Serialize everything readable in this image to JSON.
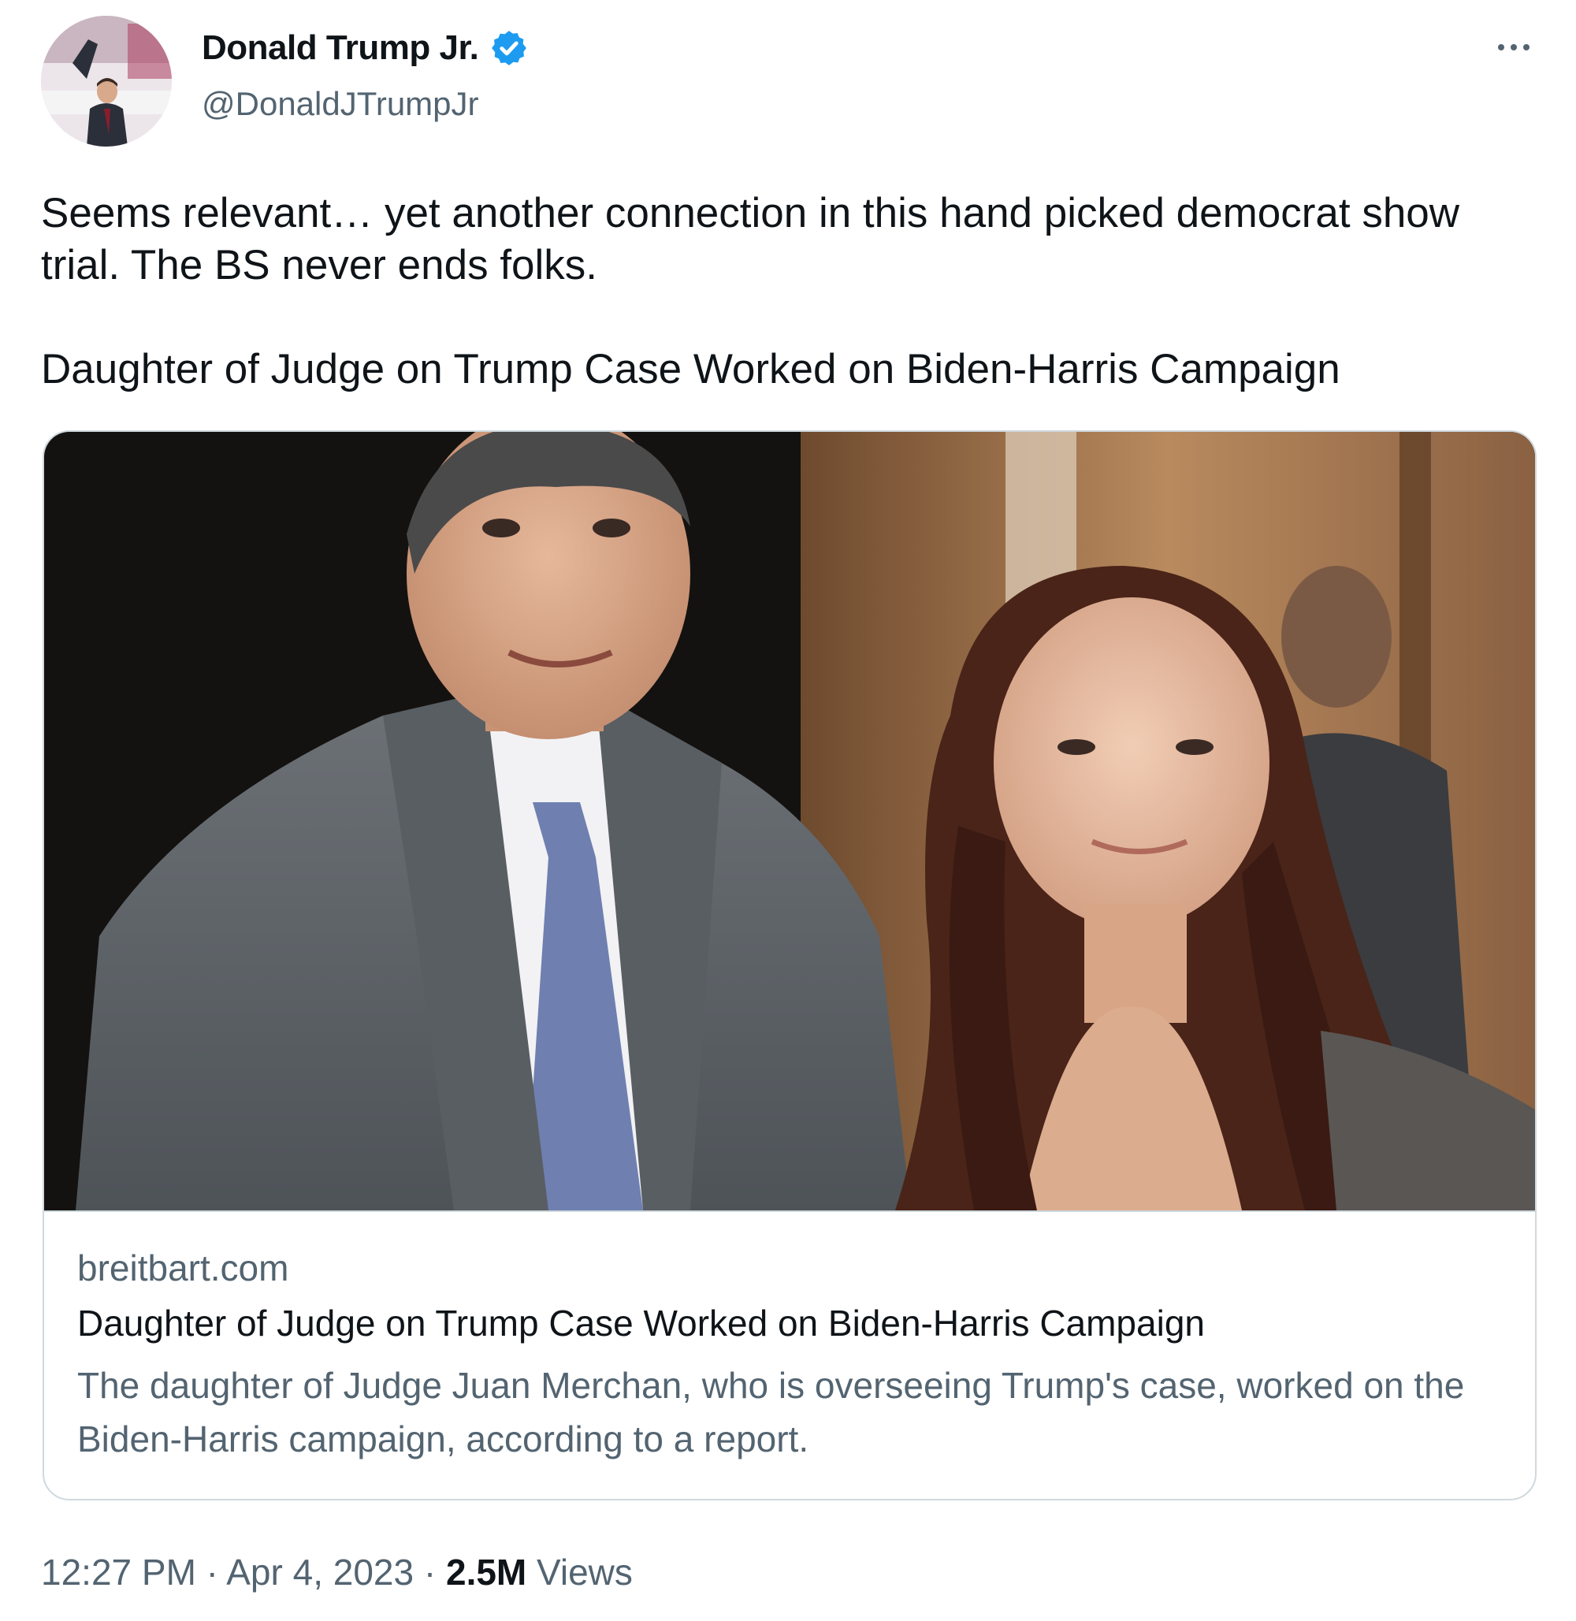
{
  "author": {
    "name": "Donald Trump Jr.",
    "handle": "@DonaldJTrumpJr",
    "verified_badge_icon": "verified-badge-icon",
    "badge_color": "#1d9bf0"
  },
  "tweet": {
    "text": "Seems relevant… yet another connection in this hand picked democrat show trial. The BS never ends folks.\n\nDaughter of Judge on Trump Case Worked on Biden-Harris Campaign"
  },
  "link_card": {
    "domain": "breitbart.com",
    "title": "Daughter of Judge on Trump Case Worked on Biden-Harris Campaign",
    "description": "The daughter of Judge Juan Merchan, who is overseeing Trump's case, worked on the Biden-Harris campaign, according to a report."
  },
  "meta": {
    "time": "12:27 PM",
    "separator": " · ",
    "date": "Apr 4, 2023",
    "views_count": "2.5M",
    "views_label": " Views"
  },
  "icons": {
    "more": "more-options-icon"
  }
}
